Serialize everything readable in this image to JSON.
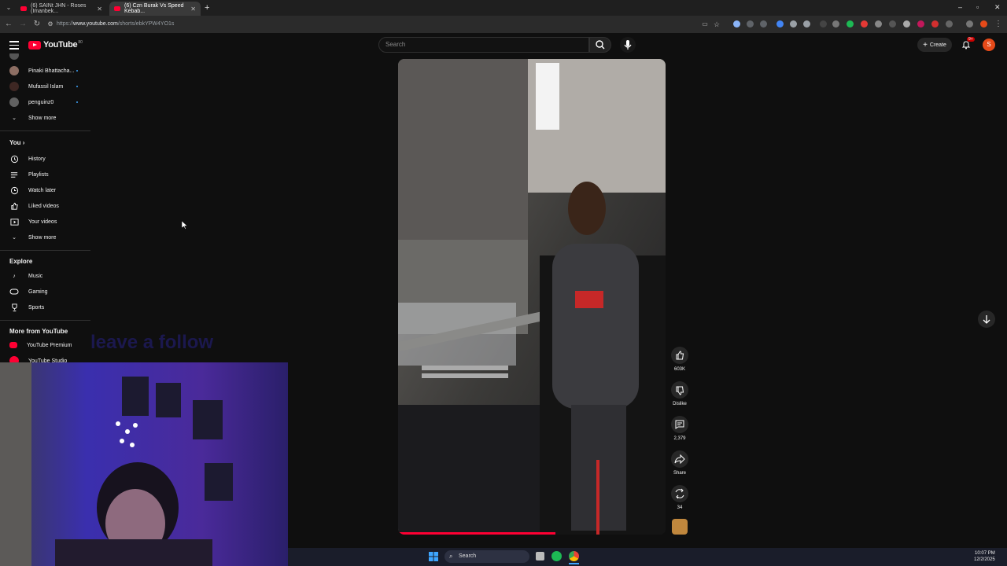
{
  "browser": {
    "tabs": [
      {
        "title": "(6) SAINt JHN - Roses (Imanbek..."
      },
      {
        "title": "(6) Czn Burak Vs Speed Kebab..."
      }
    ],
    "url_scheme": "https://",
    "url_host": "www.youtube.com",
    "url_path": "/shorts/ebkYPW4YO1s"
  },
  "header": {
    "logo_text": "YouTube",
    "logo_badge": "80",
    "search_placeholder": "Search",
    "create_label": "Create",
    "notification_count": "9+",
    "avatar_letter": "S"
  },
  "sidebar": {
    "subscriptions": [
      {
        "name": "Pinaki Bhattacha...",
        "new": true
      },
      {
        "name": "Mufassil Islam",
        "new": true
      },
      {
        "name": "penguinz0",
        "new": true
      }
    ],
    "show_more_1": "Show more",
    "you_heading": "You",
    "you_items": [
      {
        "label": "History",
        "icon": "history-icon"
      },
      {
        "label": "Playlists",
        "icon": "playlists-icon"
      },
      {
        "label": "Watch later",
        "icon": "watch-later-icon"
      },
      {
        "label": "Liked videos",
        "icon": "like-icon"
      },
      {
        "label": "Your videos",
        "icon": "your-videos-icon"
      }
    ],
    "show_more_2": "Show more",
    "explore_heading": "Explore",
    "explore_items": [
      {
        "label": "Music",
        "icon": "music-icon"
      },
      {
        "label": "Gaming",
        "icon": "gaming-icon"
      },
      {
        "label": "Sports",
        "icon": "trophy-icon"
      }
    ],
    "more_heading": "More from YouTube",
    "more_items": [
      {
        "label": "YouTube Premium"
      },
      {
        "label": "YouTube Studio"
      }
    ]
  },
  "short": {
    "likes": "603K",
    "dislike_label": "Dislike",
    "comments": "2,379",
    "share_label": "Share",
    "remix_count": "34"
  },
  "overlay_text": "leave a follow",
  "taskbar": {
    "search_label": "Search",
    "time": "10:07 PM",
    "date": "12/2/2025"
  }
}
